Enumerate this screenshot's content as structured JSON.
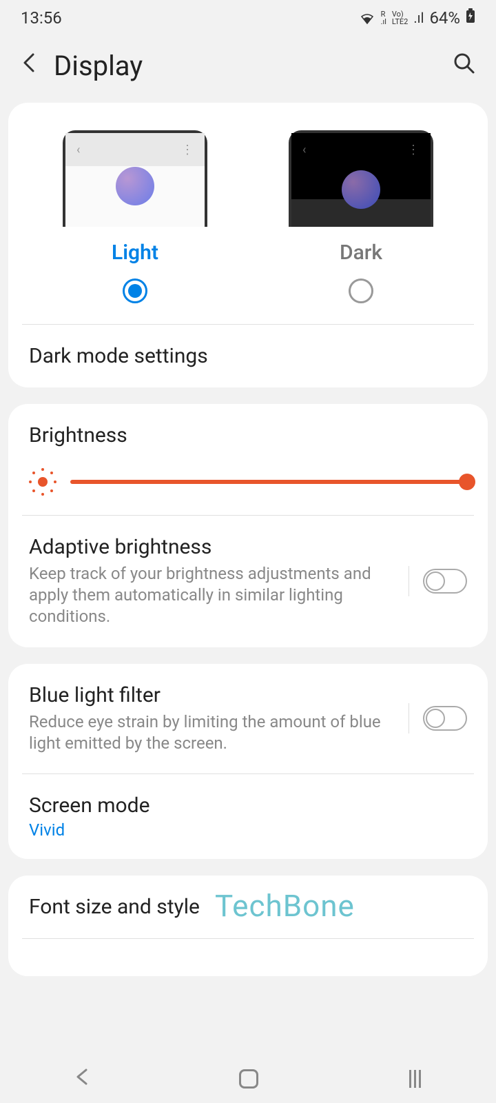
{
  "status_bar": {
    "time": "13:56",
    "battery": "64%"
  },
  "header": {
    "title": "Display"
  },
  "theme": {
    "light_label": "Light",
    "dark_label": "Dark",
    "selected": "light"
  },
  "dark_mode_settings": {
    "label": "Dark mode settings"
  },
  "brightness": {
    "label": "Brightness",
    "value": 100
  },
  "adaptive_brightness": {
    "title": "Adaptive brightness",
    "description": "Keep track of your brightness adjustments and apply them automatically in similar lighting conditions.",
    "enabled": false
  },
  "blue_light": {
    "title": "Blue light filter",
    "description": "Reduce eye strain by limiting the amount of blue light emitted by the screen.",
    "enabled": false
  },
  "screen_mode": {
    "title": "Screen mode",
    "value": "Vivid"
  },
  "font_size": {
    "title": "Font size and style"
  },
  "watermark": "TechBone"
}
